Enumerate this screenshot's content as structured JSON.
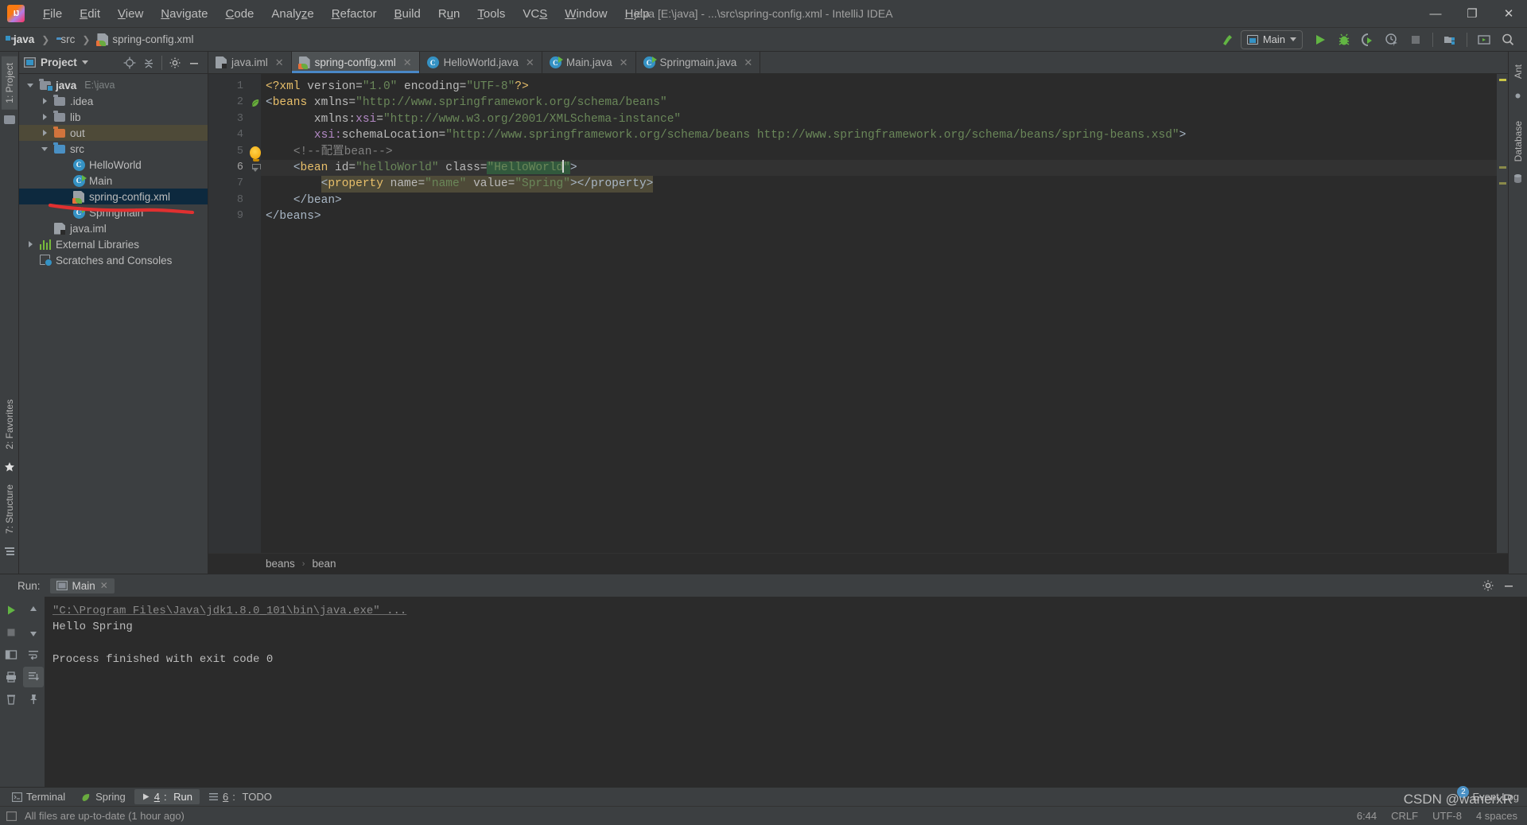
{
  "window": {
    "title": "java [E:\\java] - ...\\src\\spring-config.xml - IntelliJ IDEA",
    "minimize": "—",
    "maximize": "❐",
    "close": "✕"
  },
  "menu": [
    {
      "label": "File"
    },
    {
      "label": "Edit"
    },
    {
      "label": "View"
    },
    {
      "label": "Navigate"
    },
    {
      "label": "Code"
    },
    {
      "label": "Analyze"
    },
    {
      "label": "Refactor"
    },
    {
      "label": "Build"
    },
    {
      "label": "Run"
    },
    {
      "label": "Tools"
    },
    {
      "label": "VCS"
    },
    {
      "label": "Window"
    },
    {
      "label": "Help"
    }
  ],
  "breadcrumb": {
    "project": "java",
    "folder": "src",
    "file": "spring-config.xml"
  },
  "toolbar": {
    "run_config": "Main",
    "build_tooltip": "Build",
    "run_tooltip": "Run",
    "debug_tooltip": "Debug",
    "coverage_tooltip": "Run with Coverage",
    "profile_tooltip": "Profile",
    "stop_tooltip": "Stop",
    "structure_tooltip": "Project Structure",
    "updates_tooltip": "Updates",
    "search_tooltip": "Search Everywhere"
  },
  "left_strip": {
    "project_tab": "1: Project",
    "favorites_tab": "2: Favorites",
    "structure_tab": "7: Structure"
  },
  "right_strip": {
    "ant_tab": "Ant",
    "database_tab": "Database"
  },
  "project_panel": {
    "title": "Project",
    "locate_icon": "locate-icon",
    "collapse_icon": "collapse-all-icon",
    "settings_icon": "gear-icon",
    "hide_icon": "hide-icon",
    "tree": [
      {
        "label": "java",
        "sub": "E:\\java",
        "icon": "module-folder-icon",
        "depth": 0,
        "arrow": "down",
        "bold": true,
        "state": "normal"
      },
      {
        "label": ".idea",
        "sub": "",
        "icon": "folder-icon",
        "depth": 1,
        "arrow": "right",
        "bold": false,
        "state": "normal"
      },
      {
        "label": "lib",
        "sub": "",
        "icon": "folder-icon",
        "depth": 1,
        "arrow": "right",
        "bold": false,
        "state": "normal"
      },
      {
        "label": "out",
        "sub": "",
        "icon": "folder-orange-icon",
        "depth": 1,
        "arrow": "right",
        "bold": false,
        "state": "highlight"
      },
      {
        "label": "src",
        "sub": "",
        "icon": "folder-blue-icon",
        "depth": 1,
        "arrow": "down",
        "bold": false,
        "state": "normal"
      },
      {
        "label": "HelloWorld",
        "sub": "",
        "icon": "java-class-icon",
        "depth": 2,
        "arrow": "none",
        "bold": false,
        "state": "normal"
      },
      {
        "label": "Main",
        "sub": "",
        "icon": "java-class-runnable-icon",
        "depth": 2,
        "arrow": "none",
        "bold": false,
        "state": "normal"
      },
      {
        "label": "spring-config.xml",
        "sub": "",
        "icon": "spring-xml-icon",
        "depth": 2,
        "arrow": "none",
        "bold": false,
        "state": "selected"
      },
      {
        "label": "Springmain",
        "sub": "",
        "icon": "java-class-runnable-icon",
        "depth": 2,
        "arrow": "none",
        "bold": false,
        "state": "normal"
      },
      {
        "label": "java.iml",
        "sub": "",
        "icon": "iml-file-icon",
        "depth": 1,
        "arrow": "none",
        "bold": false,
        "state": "normal"
      },
      {
        "label": "External Libraries",
        "sub": "",
        "icon": "libraries-icon",
        "depth": 0,
        "arrow": "right",
        "bold": false,
        "state": "normal"
      },
      {
        "label": "Scratches and Consoles",
        "sub": "",
        "icon": "scratches-icon",
        "depth": 0,
        "arrow": "none",
        "bold": false,
        "state": "normal"
      }
    ]
  },
  "editor": {
    "tabs": [
      {
        "label": "java.iml",
        "icon": "iml-file-icon",
        "active": false
      },
      {
        "label": "spring-config.xml",
        "icon": "spring-xml-icon",
        "active": true
      },
      {
        "label": "HelloWorld.java",
        "icon": "java-class-icon",
        "active": false
      },
      {
        "label": "Main.java",
        "icon": "java-class-runnable-icon",
        "active": false
      },
      {
        "label": "Springmain.java",
        "icon": "java-class-runnable-icon",
        "active": false
      }
    ],
    "close_glyph": "✕",
    "line_numbers": [
      "1",
      "2",
      "3",
      "4",
      "5",
      "6",
      "7",
      "8",
      "9"
    ],
    "code_lines": [
      {
        "n": 1,
        "text": "<?xml version=\"1.0\" encoding=\"UTF-8\"?>"
      },
      {
        "n": 2,
        "text": "<beans xmlns=\"http://www.springframework.org/schema/beans\""
      },
      {
        "n": 3,
        "text": "       xmlns:xsi=\"http://www.w3.org/2001/XMLSchema-instance\""
      },
      {
        "n": 4,
        "text": "       xsi:schemaLocation=\"http://www.springframework.org/schema/beans http://www.springframework.org/schema/beans/spring-beans.xsd\">"
      },
      {
        "n": 5,
        "text": "    <!--配置bean-->"
      },
      {
        "n": 6,
        "text": "    <bean id=\"helloWorld\" class=\"HelloWorld\">"
      },
      {
        "n": 7,
        "text": "        <property name=\"name\" value=\"Spring\"></property>"
      },
      {
        "n": 8,
        "text": "    </bean>"
      },
      {
        "n": 9,
        "text": "</beans>"
      }
    ],
    "tokens": {
      "l1_open": "<?xml",
      "l1_attr1": " version=",
      "l1_v1": "\"1.0\"",
      "l1_attr2": " encoding=",
      "l1_v2": "\"UTF-8\"",
      "l1_close": "?>",
      "l2_lt": "<",
      "l2_tag": "beans",
      "l2_attr": " xmlns=",
      "l2_val": "\"http://www.springframework.org/schema/beans\"",
      "l3_indent": "       ",
      "l3_attr": "xmlns:",
      "l3_ns": "xsi",
      "l3_eq": "=",
      "l3_val": "\"http://www.w3.org/2001/XMLSchema-instance\"",
      "l4_indent": "       ",
      "l4_ns": "xsi:",
      "l4_attr": "schemaLocation=",
      "l4_val": "\"http://www.springframework.org/schema/beans http://www.springframework.org/schema/beans/spring-beans.xsd\"",
      "l4_gt": ">",
      "l5_comment": "<!--配置bean-->",
      "l6_lt": "<",
      "l6_tag": "bean",
      "l6_attr1": " id=",
      "l6_v1": "\"helloWorld\"",
      "l6_attr2": " class=",
      "l6_v2q": "\"",
      "l6_v2": "HelloWorld",
      "l6_v2qe": "\"",
      "l6_gt": ">",
      "l7_lt": "<",
      "l7_tag": "property",
      "l7_attr1": " name=",
      "l7_v1": "\"name\"",
      "l7_attr2": " value=",
      "l7_v2": "\"Spring\"",
      "l7_gt": ">",
      "l7_close": "</property>",
      "l8_close": "</bean>",
      "l9_close": "</beans>"
    },
    "breadcrumb": {
      "root": "beans",
      "child": "bean",
      "sep": "›"
    }
  },
  "run_panel": {
    "label": "Run:",
    "tab": "Main",
    "tab_close": "✕",
    "settings_icon": "gear-icon",
    "hide_icon": "hide-icon",
    "console": [
      {
        "type": "cmd",
        "text": "\"C:\\Program Files\\Java\\jdk1.8.0_101\\bin\\java.exe\" ..."
      },
      {
        "type": "out",
        "text": "Hello Spring"
      },
      {
        "type": "blank",
        "text": ""
      },
      {
        "type": "out",
        "text": "Process finished with exit code 0"
      }
    ],
    "buttons": {
      "rerun": "rerun-icon",
      "stop": "stop-icon",
      "up": "up-arrow-icon",
      "down": "down-arrow-icon",
      "print": "print-icon",
      "trash": "trash-icon",
      "wrap": "soft-wrap-icon",
      "scroll": "scroll-to-end-icon",
      "pin": "pin-icon",
      "layout": "layout-icon"
    }
  },
  "tool_windows": [
    {
      "label": "Terminal",
      "icon": "terminal-icon",
      "num": "",
      "active": false
    },
    {
      "label": "Spring",
      "icon": "spring-icon",
      "num": "",
      "active": false
    },
    {
      "label": "Run",
      "icon": "run-icon",
      "num": "4",
      "active": true
    },
    {
      "label": "TODO",
      "icon": "todo-icon",
      "num": "6",
      "active": false
    }
  ],
  "status_bar": {
    "message": "All files are up-to-date (1 hour ago)",
    "position": "6:44",
    "line_sep": "CRLF",
    "encoding": "UTF-8",
    "indent": "4 spaces",
    "event_log": "Event Log",
    "event_count": "2"
  },
  "watermark": "CSDN @wanerxR",
  "colors": {
    "accent_blue": "#4a88c7",
    "selection_blue": "#0d293e",
    "highlight_tan": "#4e4a38",
    "annotation_red": "#e03030",
    "green_run": "#62b543",
    "string_green": "#6a8759",
    "tag_yellow": "#e8bf6a",
    "ns_purple": "#b389c5",
    "bg_editor": "#2b2b2b",
    "bg_chrome": "#3c3f41"
  }
}
